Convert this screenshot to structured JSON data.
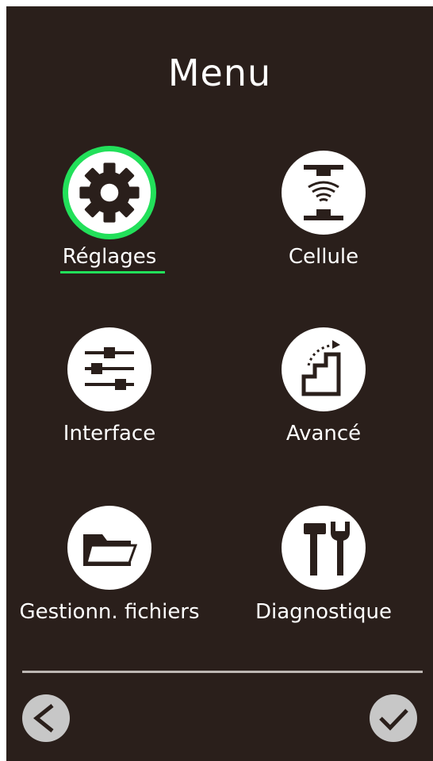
{
  "title": "Menu",
  "items": [
    {
      "label": "Réglages",
      "icon": "gear-icon",
      "selected": true
    },
    {
      "label": "Cellule",
      "icon": "sensor-icon",
      "selected": false
    },
    {
      "label": "Interface",
      "icon": "sliders-icon",
      "selected": false
    },
    {
      "label": "Avancé",
      "icon": "stairs-icon",
      "selected": false
    },
    {
      "label": "Gestionn. fichiers",
      "icon": "folder-icon",
      "selected": false
    },
    {
      "label": "Diagnostique",
      "icon": "tools-icon",
      "selected": false
    }
  ],
  "nav": {
    "back_icon": "chevron-left-icon",
    "confirm_icon": "checkmark-icon"
  },
  "colors": {
    "background": "#2a1f1b",
    "accent": "#22e05a",
    "text": "#ffffff",
    "nav_button": "#c7c7c7",
    "divider": "#bdb7b3"
  }
}
